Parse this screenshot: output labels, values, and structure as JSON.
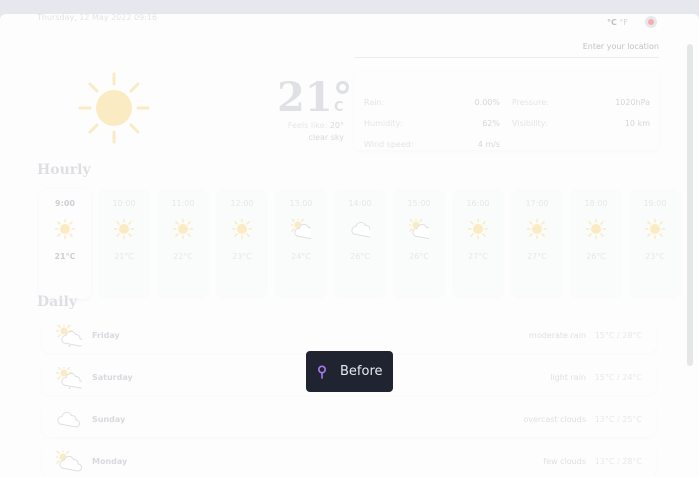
{
  "header": {
    "date": "Thursday, 12 May 2022 09:16",
    "unit_c": "°C",
    "unit_f": "°F",
    "settings_icon": "gear-icon"
  },
  "search": {
    "placeholder": "Enter your location"
  },
  "current": {
    "icon": "sun-icon",
    "temperature": "21°",
    "unit": "C",
    "feels_like_label": "Feels like:",
    "feels_like_value": "20°",
    "description": "clear sky"
  },
  "stats": {
    "rain_label": "Rain:",
    "rain_value": "0.00%",
    "pressure_label": "Pressure:",
    "pressure_value": "1020hPa",
    "humidity_label": "Humidity:",
    "humidity_value": "62%",
    "visibility_label": "Visibility:",
    "visibility_value": "10 km",
    "wind_label": "Wind speed:",
    "wind_value": "4 m/s"
  },
  "hourly_title": "Hourly",
  "hourly": [
    {
      "time": "9:00",
      "temp": "21°C",
      "icon": "sun"
    },
    {
      "time": "10:00",
      "temp": "21°C",
      "icon": "sun"
    },
    {
      "time": "11:00",
      "temp": "22°C",
      "icon": "sun"
    },
    {
      "time": "12:00",
      "temp": "23°C",
      "icon": "sun"
    },
    {
      "time": "13:00",
      "temp": "24°C",
      "icon": "partly-cloudy"
    },
    {
      "time": "14:00",
      "temp": "26°C",
      "icon": "cloud"
    },
    {
      "time": "15:00",
      "temp": "26°C",
      "icon": "partly-cloudy"
    },
    {
      "time": "16:00",
      "temp": "27°C",
      "icon": "sun"
    },
    {
      "time": "17:00",
      "temp": "27°C",
      "icon": "sun"
    },
    {
      "time": "18:00",
      "temp": "26°C",
      "icon": "sun"
    },
    {
      "time": "19:00",
      "temp": "23°C",
      "icon": "sun"
    }
  ],
  "daily_title": "Daily",
  "daily": [
    {
      "day": "Friday",
      "desc": "moderate rain",
      "range": "15°C / 28°C",
      "icon": "sun-rain"
    },
    {
      "day": "Saturday",
      "desc": "light rain",
      "range": "15°C / 24°C",
      "icon": "sun-rain"
    },
    {
      "day": "Sunday",
      "desc": "overcast clouds",
      "range": "13°C / 25°C",
      "icon": "cloud"
    },
    {
      "day": "Monday",
      "desc": "few clouds",
      "range": "13°C / 28°C",
      "icon": "partly-cloudy"
    }
  ],
  "tooltip": {
    "label": "Before",
    "icon": "pin-icon"
  },
  "colors": {
    "sun": "#f6d27a",
    "cloud": "#c9ccd3",
    "tooltip_bg": "#1f2430",
    "accent": "#e64b4b",
    "pin": "#a57cf0"
  }
}
